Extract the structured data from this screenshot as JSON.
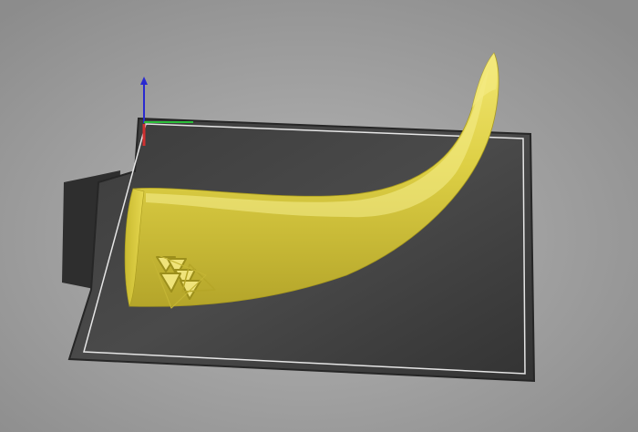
{
  "viewport": {
    "background": "#9a9a9a",
    "background_center": "#b4b4b4"
  },
  "bed": {
    "surface_color": "#3a3a3a",
    "surface_edge_color": "#262626",
    "print_area_outline_color": "#e6e6e6"
  },
  "axes": {
    "x_color": "#2bbf3a",
    "y_color": "#d03030",
    "z_color": "#2a2ad0"
  },
  "model": {
    "name": "horn",
    "color": "#e2d44a",
    "highlight_color": "#f3ea7a",
    "shadow_color": "#a89a1e",
    "emblem_icon": "valknut-triangles-icon"
  }
}
